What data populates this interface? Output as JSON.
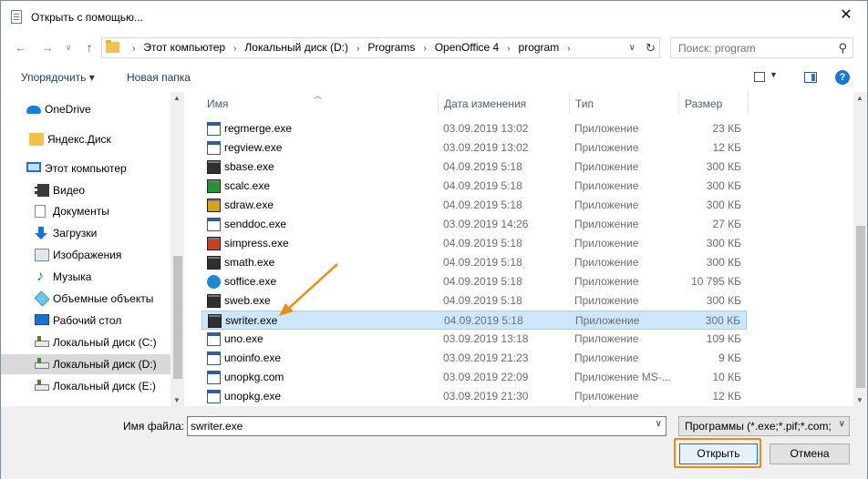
{
  "window": {
    "title": "Открыть с помощью..."
  },
  "addressbar": {
    "crumbs": [
      "Этот компьютер",
      "Локальный диск (D:)",
      "Programs",
      "OpenOffice 4",
      "program"
    ],
    "search_placeholder": "Поиск: program"
  },
  "toolbar": {
    "organize_label": "Упорядочить ▾",
    "new_folder_label": "Новая папка"
  },
  "navpane": {
    "items": [
      {
        "label": "OneDrive",
        "icon": "onedrive-icon"
      },
      {
        "label": "Яндекс.Диск",
        "icon": "yandex-disk-icon"
      },
      {
        "label": "Этот компьютер",
        "icon": "computer-icon"
      },
      {
        "label": "Видео",
        "icon": "video-icon"
      },
      {
        "label": "Документы",
        "icon": "documents-icon"
      },
      {
        "label": "Загрузки",
        "icon": "downloads-icon"
      },
      {
        "label": "Изображения",
        "icon": "pictures-icon"
      },
      {
        "label": "Музыка",
        "icon": "music-icon"
      },
      {
        "label": "Объемные объекты",
        "icon": "3d-objects-icon"
      },
      {
        "label": "Рабочий стол",
        "icon": "desktop-icon"
      },
      {
        "label": "Локальный диск (C:)",
        "icon": "drive-icon"
      },
      {
        "label": "Локальный диск (D:)",
        "icon": "drive-icon",
        "selected": true
      },
      {
        "label": "Локальный диск (E:)",
        "icon": "drive-icon"
      }
    ]
  },
  "filelist": {
    "columns": {
      "name": "Имя",
      "date": "Дата изменения",
      "type": "Тип",
      "size": "Размер"
    },
    "files": [
      {
        "name": "regmerge.exe",
        "date": "03.09.2019 13:02",
        "type": "Приложение",
        "size": "23 КБ",
        "icon": "app-icon"
      },
      {
        "name": "regview.exe",
        "date": "03.09.2019 13:02",
        "type": "Приложение",
        "size": "12 КБ",
        "icon": "app-icon"
      },
      {
        "name": "sbase.exe",
        "date": "04.09.2019 5:18",
        "type": "Приложение",
        "size": "300 КБ",
        "icon": "openoffice-base-icon"
      },
      {
        "name": "scalc.exe",
        "date": "04.09.2019 5:18",
        "type": "Приложение",
        "size": "300 КБ",
        "icon": "openoffice-calc-icon"
      },
      {
        "name": "sdraw.exe",
        "date": "04.09.2019 5:18",
        "type": "Приложение",
        "size": "300 КБ",
        "icon": "openoffice-draw-icon"
      },
      {
        "name": "senddoc.exe",
        "date": "03.09.2019 14:26",
        "type": "Приложение",
        "size": "27 КБ",
        "icon": "app-icon"
      },
      {
        "name": "simpress.exe",
        "date": "04.09.2019 5:18",
        "type": "Приложение",
        "size": "300 КБ",
        "icon": "openoffice-impress-icon"
      },
      {
        "name": "smath.exe",
        "date": "04.09.2019 5:18",
        "type": "Приложение",
        "size": "300 КБ",
        "icon": "openoffice-math-icon"
      },
      {
        "name": "soffice.exe",
        "date": "04.09.2019 5:18",
        "type": "Приложение",
        "size": "10 795 КБ",
        "icon": "openoffice-icon"
      },
      {
        "name": "sweb.exe",
        "date": "04.09.2019 5:18",
        "type": "Приложение",
        "size": "300 КБ",
        "icon": "openoffice-web-icon"
      },
      {
        "name": "swriter.exe",
        "date": "04.09.2019 5:18",
        "type": "Приложение",
        "size": "300 КБ",
        "icon": "openoffice-writer-icon",
        "selected": true
      },
      {
        "name": "uno.exe",
        "date": "03.09.2019 13:18",
        "type": "Приложение",
        "size": "109 КБ",
        "icon": "app-icon"
      },
      {
        "name": "unoinfo.exe",
        "date": "03.09.2019 21:23",
        "type": "Приложение",
        "size": "9 КБ",
        "icon": "app-icon"
      },
      {
        "name": "unopkg.com",
        "date": "03.09.2019 22:09",
        "type": "Приложение MS-...",
        "size": "10 КБ",
        "icon": "app-icon"
      },
      {
        "name": "unopkg.exe",
        "date": "03.09.2019 21:30",
        "type": "Приложение",
        "size": "12 КБ",
        "icon": "app-icon"
      }
    ]
  },
  "footer": {
    "filename_label": "Имя файла:",
    "filename_value": "swriter.exe",
    "filter_value": "Программы (*.exe;*.pif;*.com;",
    "open_label": "Открыть",
    "cancel_label": "Отмена"
  },
  "colors": {
    "annotation": "#f08a14",
    "selection": "#cce8ff",
    "accent": "#0078d7"
  }
}
